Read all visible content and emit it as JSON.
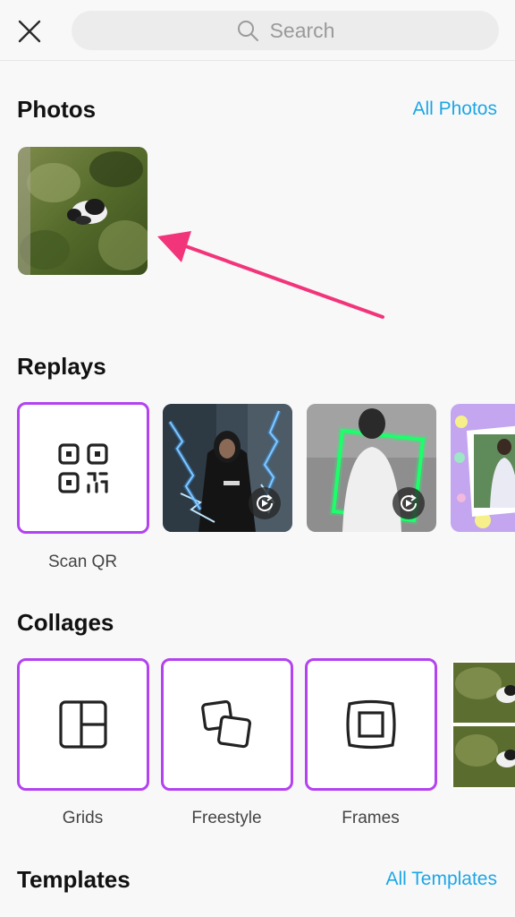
{
  "search": {
    "placeholder": "Search"
  },
  "photos": {
    "title": "Photos",
    "link": "All Photos"
  },
  "replays": {
    "title": "Replays",
    "items": [
      {
        "label": "Scan QR"
      }
    ]
  },
  "collages": {
    "title": "Collages",
    "items": [
      {
        "label": "Grids"
      },
      {
        "label": "Freestyle"
      },
      {
        "label": "Frames"
      }
    ]
  },
  "templates": {
    "title": "Templates",
    "link": "All Templates"
  },
  "colors": {
    "accent_link": "#1da6e6",
    "tile_border": "#b343f0",
    "annotation_arrow": "#f2357a"
  }
}
